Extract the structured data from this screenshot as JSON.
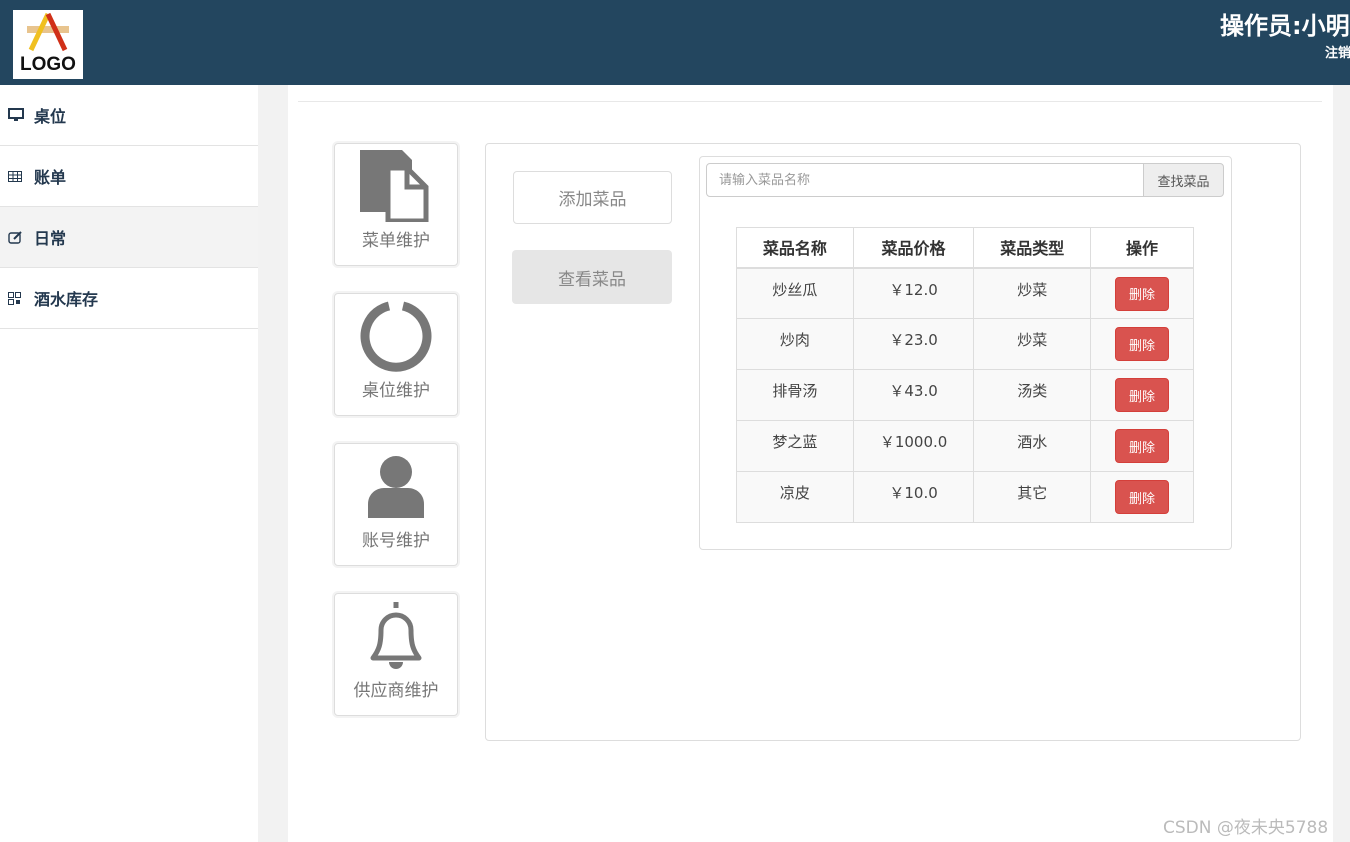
{
  "header": {
    "logo_text": "LOGO",
    "operator": "操作员:小明",
    "logout": "注销"
  },
  "sidebar": {
    "items": [
      {
        "label": "桌位",
        "icon": "desktop-icon"
      },
      {
        "label": "账单",
        "icon": "table-icon"
      },
      {
        "label": "日常",
        "icon": "edit-icon"
      },
      {
        "label": "酒水库存",
        "icon": "qrcode-icon"
      }
    ]
  },
  "tiles": [
    {
      "label": "菜单维护",
      "icon": "file-icon"
    },
    {
      "label": "桌位维护",
      "icon": "circle-notch-icon"
    },
    {
      "label": "账号维护",
      "icon": "user-icon"
    },
    {
      "label": "供应商维护",
      "icon": "bell-icon"
    }
  ],
  "actions": {
    "add": "添加菜品",
    "view": "查看菜品"
  },
  "search": {
    "placeholder": "请输入菜品名称",
    "value": "",
    "button": "查找菜品"
  },
  "table": {
    "headers": [
      "菜品名称",
      "菜品价格",
      "菜品类型",
      "操作"
    ],
    "rows": [
      {
        "name": "炒丝瓜",
        "price": "￥12.0",
        "type": "炒菜",
        "action": "删除"
      },
      {
        "name": "炒肉",
        "price": "￥23.0",
        "type": "炒菜",
        "action": "删除"
      },
      {
        "name": "排骨汤",
        "price": "￥43.0",
        "type": "汤类",
        "action": "删除"
      },
      {
        "name": "梦之蓝",
        "price": "￥1000.0",
        "type": "酒水",
        "action": "删除"
      },
      {
        "name": "凉皮",
        "price": "￥10.0",
        "type": "其它",
        "action": "删除"
      }
    ]
  },
  "watermark": "CSDN @夜未央5788",
  "colors": {
    "header": "#23465f",
    "danger": "#d9534f"
  }
}
